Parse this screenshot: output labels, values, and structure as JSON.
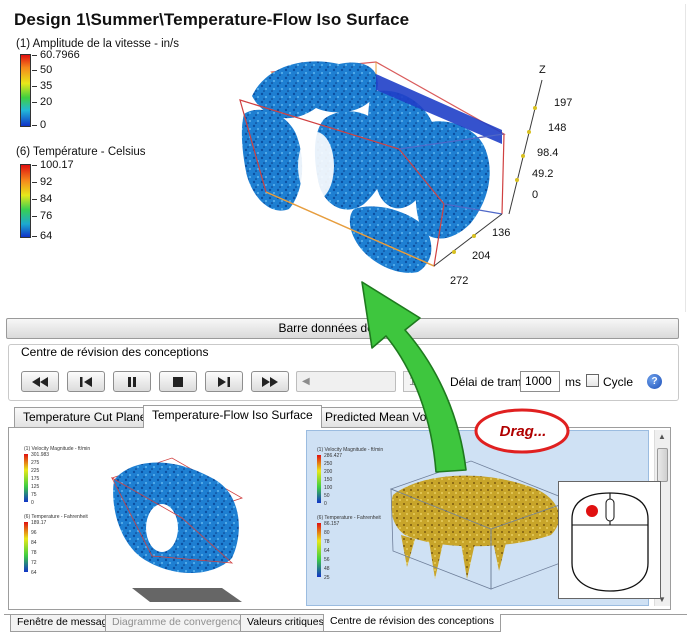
{
  "viewport": {
    "title": "Design 1\\Summer\\Temperature-Flow Iso Surface",
    "legend_velocity": {
      "title": "(1) Amplitude de la vitesse - in/s",
      "values": [
        "60.7966",
        "50",
        "35",
        "20",
        "0"
      ]
    },
    "legend_temperature": {
      "title": "(6) Température - Celsius",
      "values": [
        "100.17",
        "92",
        "84",
        "76",
        "64"
      ]
    },
    "axis": {
      "z_label": "Z",
      "z_ticks": [
        "197",
        "148",
        "98.4",
        "49.2",
        "0"
      ],
      "x_ticks": [
        "136",
        "204",
        "272"
      ]
    }
  },
  "output_bar": {
    "label": "Barre données de sortie"
  },
  "review": {
    "group_title": "Centre de révision des conceptions",
    "controls": {
      "frame_value": "1",
      "delay_label": "Délai de trame",
      "delay_value": "1000",
      "delay_unit": "ms",
      "cycle_label": "Cycle",
      "cycle_checked": false
    },
    "tabs": [
      {
        "label": "Temperature Cut Plane"
      },
      {
        "label": "Temperature-Flow Iso Surface",
        "active": true
      },
      {
        "label": "Predicted Mean Vote"
      }
    ],
    "thumbnails": [
      {
        "velocity_title": "(1) Velocity Magnitude - ft/min",
        "velocity_values": [
          "301.983",
          "275",
          "225",
          "175",
          "125",
          "75",
          "0"
        ],
        "temperature_title": "(6) Temperature - Fahrenheit",
        "temperature_values": [
          "189.17",
          "96",
          "84",
          "78",
          "72",
          "64"
        ]
      },
      {
        "velocity_title": "(1) Velocity Magnitude - ft/min",
        "velocity_values": [
          "286.427",
          "250",
          "200",
          "150",
          "100",
          "50",
          "0"
        ],
        "temperature_title": "(6) Temperature - Fahrenheit",
        "temperature_values": [
          "86.157",
          "80",
          "78",
          "64",
          "56",
          "48",
          "25"
        ]
      }
    ]
  },
  "bottom_tabs": [
    {
      "label": "Fenêtre de message",
      "state": "normal"
    },
    {
      "label": "Diagramme de convergence",
      "state": "disabled"
    },
    {
      "label": "Valeurs critiques",
      "state": "normal"
    },
    {
      "label": "Centre de révision des conceptions",
      "state": "active"
    }
  ],
  "overlay": {
    "drag_label": "Drag..."
  },
  "colors": {
    "arrow_green": "#3ec63e",
    "bubble_red": "#e02020",
    "iso_blue": "#1e7fd2",
    "iso_yellow": "#c8a52a",
    "selected_thumb_bg": "#cfe1f4"
  }
}
